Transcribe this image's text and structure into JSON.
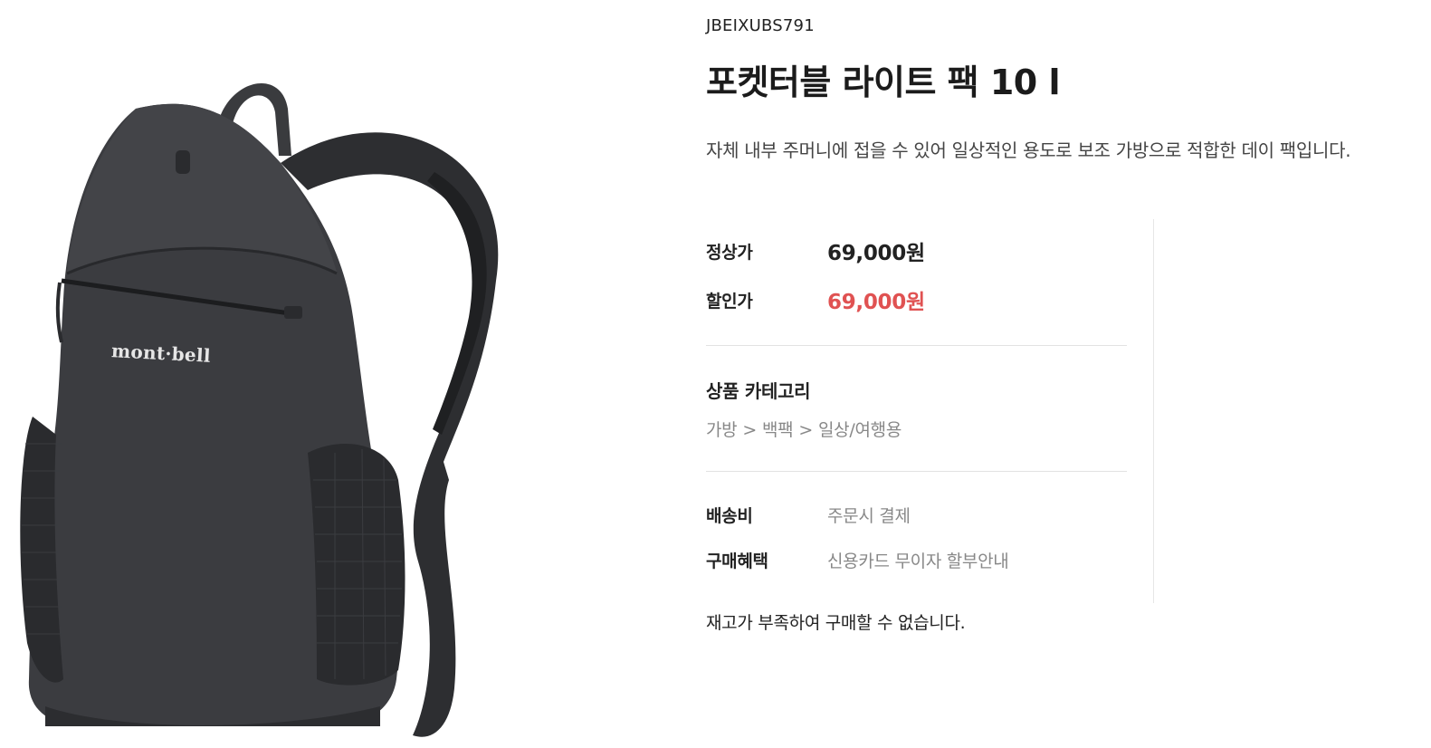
{
  "product": {
    "sku": "JBEIXUBS791",
    "title": "포켓터블 라이트 팩 10 l",
    "description": "자체 내부 주머니에 접을 수 있어 일상적인 용도로 보조 가방으로 적합한 데이 팩입니다.",
    "brand_logo_text": "mont·bell",
    "image_icon": "backpack-photo"
  },
  "pricing": {
    "regular_label": "정상가",
    "regular_price": "69,000원",
    "sale_label": "할인가",
    "sale_price": "69,000원",
    "sale_color": "#e05252"
  },
  "category": {
    "heading": "상품 카테고리",
    "path": [
      "가방",
      "백팩",
      "일상/여행용"
    ],
    "separator": ">"
  },
  "shipping": {
    "label": "배송비",
    "value": "주문시 결제"
  },
  "benefit": {
    "label": "구매혜택",
    "value": "신용카드 무이자 할부안내"
  },
  "stock_note": "재고가 부족하여 구매할 수 없습니다."
}
